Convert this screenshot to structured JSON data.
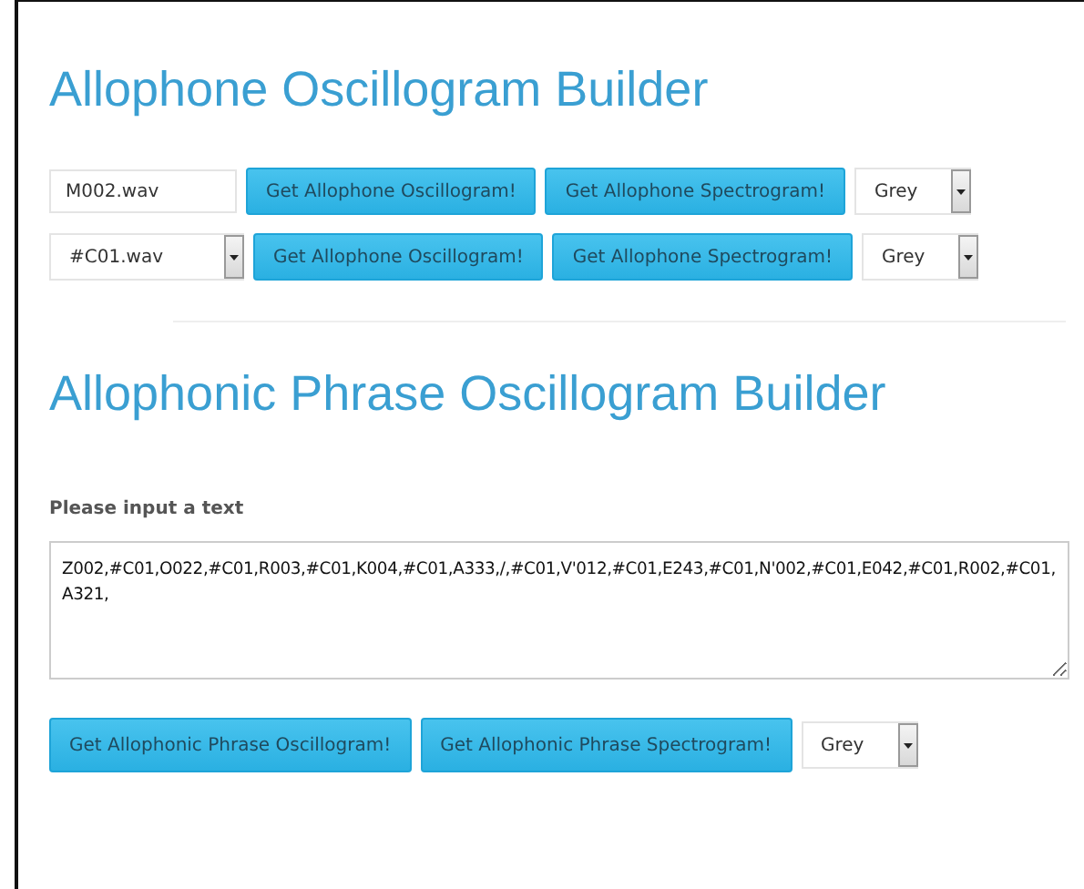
{
  "sections": [
    {
      "title": "Allophone Oscillogram Builder",
      "rows": [
        {
          "file": {
            "kind": "input",
            "value": "M002.wav"
          },
          "buttons": [
            "Get Allophone Oscillogram!",
            "Get Allophone Spectrogram!"
          ],
          "palette": "Grey"
        },
        {
          "file": {
            "kind": "select",
            "value": "#C01.wav"
          },
          "buttons": [
            "Get Allophone Oscillogram!",
            "Get Allophone Spectrogram!"
          ],
          "palette": "Grey"
        }
      ]
    },
    {
      "title": "Allophonic Phrase Oscillogram Builder",
      "label": "Please input a text",
      "text": "Z002,#C01,O022,#C01,R003,#C01,K004,#C01,A333,/,#C01,V'012,#C01,E243,#C01,N'002,#C01,E042,#C01,R002,#C01,A321,",
      "buttons": [
        "Get Allophonic Phrase Oscillogram!",
        "Get Allophonic Phrase Spectrogram!"
      ],
      "palette": "Grey"
    }
  ]
}
